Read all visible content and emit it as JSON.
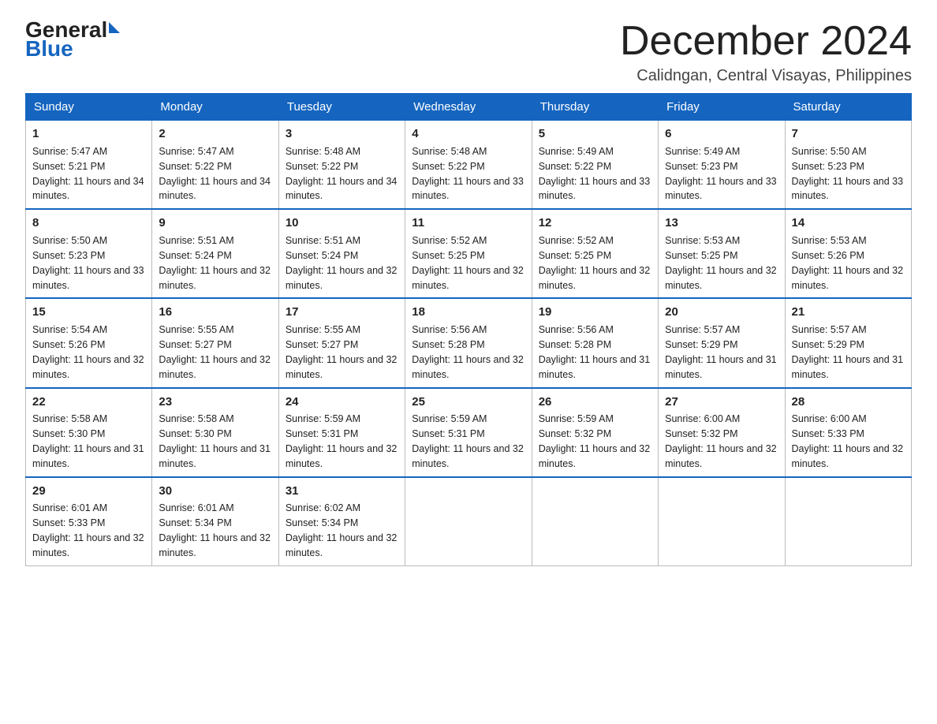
{
  "logo": {
    "general": "General",
    "blue": "Blue"
  },
  "title": "December 2024",
  "subtitle": "Calidngan, Central Visayas, Philippines",
  "days_of_week": [
    "Sunday",
    "Monday",
    "Tuesday",
    "Wednesday",
    "Thursday",
    "Friday",
    "Saturday"
  ],
  "weeks": [
    [
      {
        "day": "1",
        "sunrise": "5:47 AM",
        "sunset": "5:21 PM",
        "daylight": "11 hours and 34 minutes."
      },
      {
        "day": "2",
        "sunrise": "5:47 AM",
        "sunset": "5:22 PM",
        "daylight": "11 hours and 34 minutes."
      },
      {
        "day": "3",
        "sunrise": "5:48 AM",
        "sunset": "5:22 PM",
        "daylight": "11 hours and 34 minutes."
      },
      {
        "day": "4",
        "sunrise": "5:48 AM",
        "sunset": "5:22 PM",
        "daylight": "11 hours and 33 minutes."
      },
      {
        "day": "5",
        "sunrise": "5:49 AM",
        "sunset": "5:22 PM",
        "daylight": "11 hours and 33 minutes."
      },
      {
        "day": "6",
        "sunrise": "5:49 AM",
        "sunset": "5:23 PM",
        "daylight": "11 hours and 33 minutes."
      },
      {
        "day": "7",
        "sunrise": "5:50 AM",
        "sunset": "5:23 PM",
        "daylight": "11 hours and 33 minutes."
      }
    ],
    [
      {
        "day": "8",
        "sunrise": "5:50 AM",
        "sunset": "5:23 PM",
        "daylight": "11 hours and 33 minutes."
      },
      {
        "day": "9",
        "sunrise": "5:51 AM",
        "sunset": "5:24 PM",
        "daylight": "11 hours and 32 minutes."
      },
      {
        "day": "10",
        "sunrise": "5:51 AM",
        "sunset": "5:24 PM",
        "daylight": "11 hours and 32 minutes."
      },
      {
        "day": "11",
        "sunrise": "5:52 AM",
        "sunset": "5:25 PM",
        "daylight": "11 hours and 32 minutes."
      },
      {
        "day": "12",
        "sunrise": "5:52 AM",
        "sunset": "5:25 PM",
        "daylight": "11 hours and 32 minutes."
      },
      {
        "day": "13",
        "sunrise": "5:53 AM",
        "sunset": "5:25 PM",
        "daylight": "11 hours and 32 minutes."
      },
      {
        "day": "14",
        "sunrise": "5:53 AM",
        "sunset": "5:26 PM",
        "daylight": "11 hours and 32 minutes."
      }
    ],
    [
      {
        "day": "15",
        "sunrise": "5:54 AM",
        "sunset": "5:26 PM",
        "daylight": "11 hours and 32 minutes."
      },
      {
        "day": "16",
        "sunrise": "5:55 AM",
        "sunset": "5:27 PM",
        "daylight": "11 hours and 32 minutes."
      },
      {
        "day": "17",
        "sunrise": "5:55 AM",
        "sunset": "5:27 PM",
        "daylight": "11 hours and 32 minutes."
      },
      {
        "day": "18",
        "sunrise": "5:56 AM",
        "sunset": "5:28 PM",
        "daylight": "11 hours and 32 minutes."
      },
      {
        "day": "19",
        "sunrise": "5:56 AM",
        "sunset": "5:28 PM",
        "daylight": "11 hours and 31 minutes."
      },
      {
        "day": "20",
        "sunrise": "5:57 AM",
        "sunset": "5:29 PM",
        "daylight": "11 hours and 31 minutes."
      },
      {
        "day": "21",
        "sunrise": "5:57 AM",
        "sunset": "5:29 PM",
        "daylight": "11 hours and 31 minutes."
      }
    ],
    [
      {
        "day": "22",
        "sunrise": "5:58 AM",
        "sunset": "5:30 PM",
        "daylight": "11 hours and 31 minutes."
      },
      {
        "day": "23",
        "sunrise": "5:58 AM",
        "sunset": "5:30 PM",
        "daylight": "11 hours and 31 minutes."
      },
      {
        "day": "24",
        "sunrise": "5:59 AM",
        "sunset": "5:31 PM",
        "daylight": "11 hours and 32 minutes."
      },
      {
        "day": "25",
        "sunrise": "5:59 AM",
        "sunset": "5:31 PM",
        "daylight": "11 hours and 32 minutes."
      },
      {
        "day": "26",
        "sunrise": "5:59 AM",
        "sunset": "5:32 PM",
        "daylight": "11 hours and 32 minutes."
      },
      {
        "day": "27",
        "sunrise": "6:00 AM",
        "sunset": "5:32 PM",
        "daylight": "11 hours and 32 minutes."
      },
      {
        "day": "28",
        "sunrise": "6:00 AM",
        "sunset": "5:33 PM",
        "daylight": "11 hours and 32 minutes."
      }
    ],
    [
      {
        "day": "29",
        "sunrise": "6:01 AM",
        "sunset": "5:33 PM",
        "daylight": "11 hours and 32 minutes."
      },
      {
        "day": "30",
        "sunrise": "6:01 AM",
        "sunset": "5:34 PM",
        "daylight": "11 hours and 32 minutes."
      },
      {
        "day": "31",
        "sunrise": "6:02 AM",
        "sunset": "5:34 PM",
        "daylight": "11 hours and 32 minutes."
      },
      null,
      null,
      null,
      null
    ]
  ]
}
